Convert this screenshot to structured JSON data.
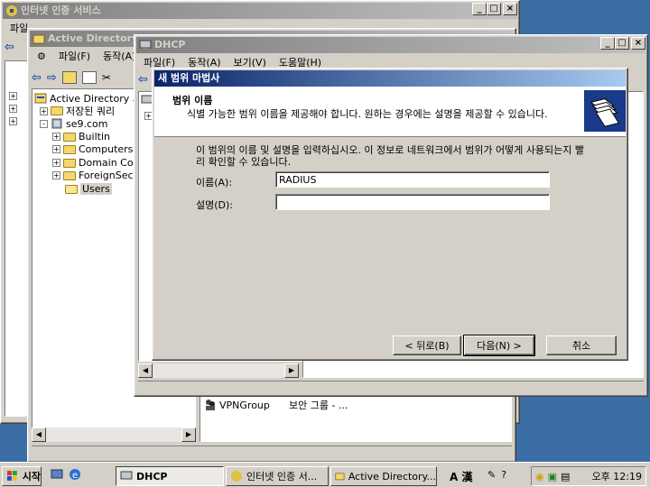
{
  "windows": {
    "ias": {
      "title": "인터넷 인증 서비스",
      "menu": [
        "파일"
      ]
    },
    "ad": {
      "title": "Active Directory",
      "menu": [
        "파일(F)",
        "동작(A)"
      ],
      "tree": [
        {
          "label": "Active Directory 사"
        },
        {
          "label": "저장된 쿼리"
        },
        {
          "label": "se9.com"
        },
        {
          "label": "Builtin"
        },
        {
          "label": "Computers"
        },
        {
          "label": "Domain Co"
        },
        {
          "label": "ForeignSec"
        },
        {
          "label": "Users"
        }
      ],
      "list_row": {
        "name": "VPNGroup",
        "type": "보안 그룹 - ..."
      }
    },
    "dhcp": {
      "title": "DHCP",
      "menu": [
        "파일(F)",
        "동작(A)",
        "보기(V)",
        "도움말(H)"
      ]
    }
  },
  "wizard": {
    "title": "새 범위 마법사",
    "header_title": "범위 이름",
    "header_desc": "식별 가능한 범위 이름을 제공해야 합니다. 원하는 경우에는 설명을 제공할 수 있습니다.",
    "instruction": "이 범위의 이름 및 설명을 입력하십시오. 이 정보로 네트워크에서 범위가 어떻게 사용되는지 빨리 확인할 수 있습니다.",
    "name_label": "이름(A):",
    "name_value": "RADIUS",
    "desc_label": "설명(D):",
    "desc_value": "",
    "back_button": "< 뒤로(B)",
    "next_button": "다음(N) >",
    "cancel_button": "취소"
  },
  "taskbar": {
    "start": "시작",
    "tasks": [
      {
        "label": "DHCP"
      },
      {
        "label": "인터넷 인증 서..."
      },
      {
        "label": "Active Directory..."
      }
    ],
    "ime": "A 漢",
    "clock": "오후 12:19"
  },
  "colors": {
    "active_title": "#0a246a",
    "inactive_title": "#808080",
    "desktop": "#3a6ea5",
    "face": "#d4d0c8"
  }
}
